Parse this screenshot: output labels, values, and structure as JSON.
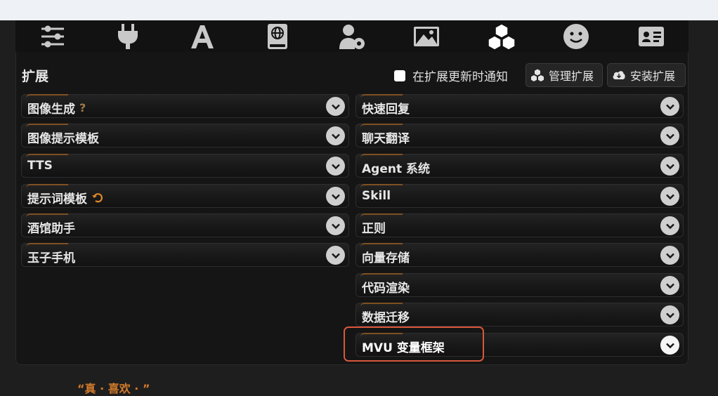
{
  "panel": {
    "title": "扩展"
  },
  "header": {
    "notify_label": "在扩展更新时通知",
    "notify_checked": false,
    "manage_label": "管理扩展",
    "install_label": "安装扩展"
  },
  "topbar_icons": [
    "sliders-icon",
    "plug-icon",
    "font-icon",
    "book-globe-icon",
    "user-gear-icon",
    "image-icon",
    "cubes-icon",
    "smile-icon",
    "id-card-icon"
  ],
  "left_drawers": [
    {
      "label": "图像生成",
      "badge": "?"
    },
    {
      "label": "图像提示模板"
    },
    {
      "label": "TTS"
    },
    {
      "label": "提示词模板"
    },
    {
      "label": "酒馆助手"
    },
    {
      "label": "玉子手机"
    }
  ],
  "right_drawers": [
    {
      "label": "快速回复"
    },
    {
      "label": "聊天翻译"
    },
    {
      "label": "Agent 系统"
    },
    {
      "label": "Skill"
    },
    {
      "label": "正则"
    },
    {
      "label": "向量存储"
    },
    {
      "label": "代码渲染"
    },
    {
      "label": "数据迁移"
    },
    {
      "label": "MVU 变量框架"
    }
  ],
  "colors": {
    "accent": "#d9573c",
    "badge": "#a0784a",
    "bottom_text": "#d27a2a"
  },
  "bottom": {
    "text": "“真 · 喜欢 · ”"
  }
}
